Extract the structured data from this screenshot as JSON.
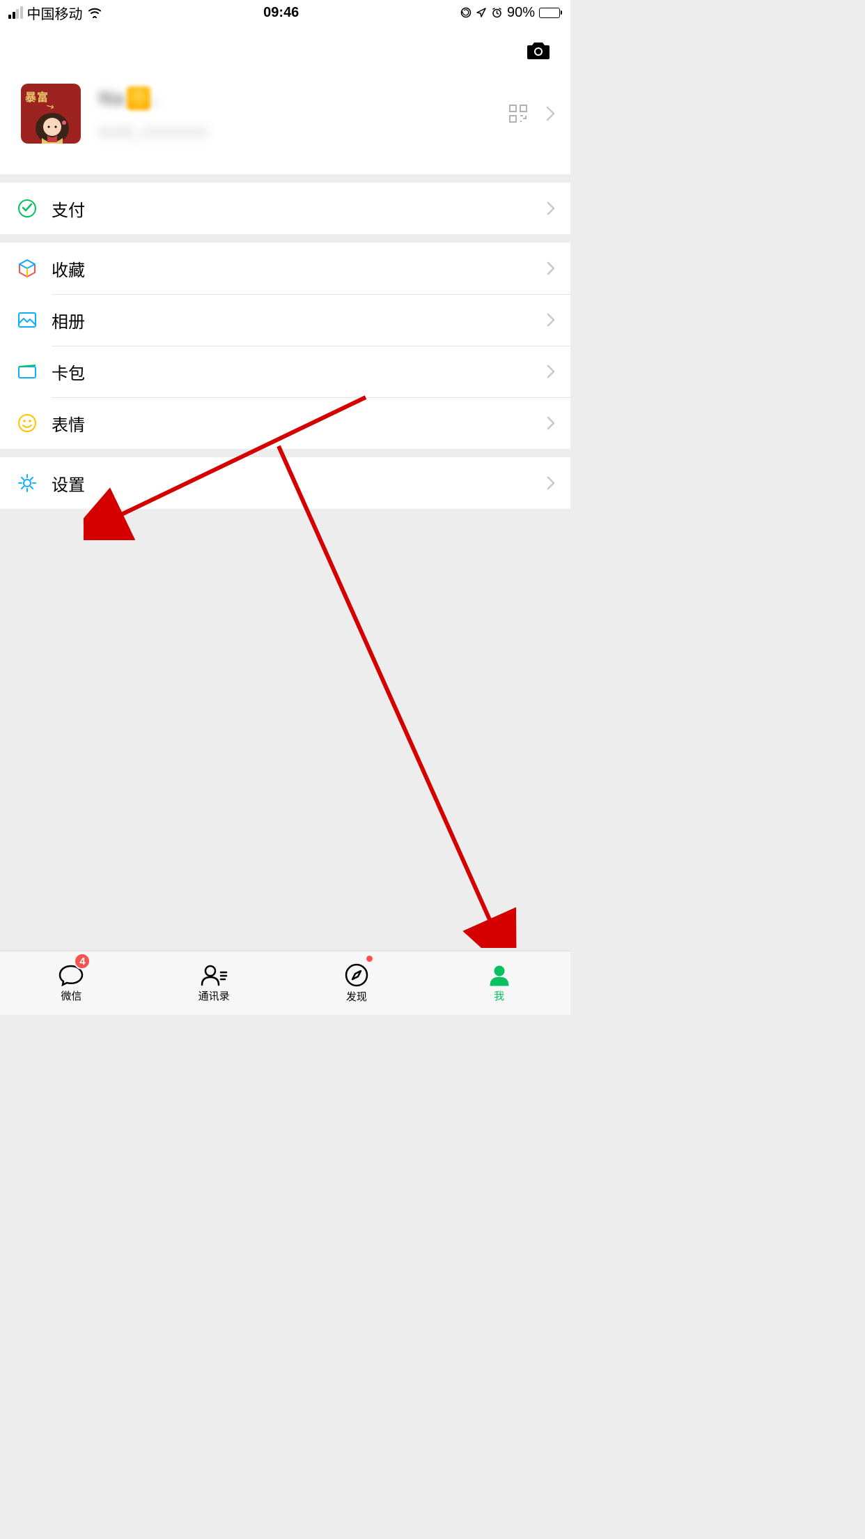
{
  "status_bar": {
    "carrier": "中国移动",
    "time": "09:46",
    "battery_percent": "90%"
  },
  "profile": {
    "avatar_text": "暴富",
    "nickname_blurred": "Na",
    "wechat_id_blurred": "wxid_xxxxxxxx"
  },
  "menu": {
    "items": [
      {
        "label": "支付",
        "icon": "pay"
      },
      {
        "label": "收藏",
        "icon": "favorites"
      },
      {
        "label": "相册",
        "icon": "album"
      },
      {
        "label": "卡包",
        "icon": "cards"
      },
      {
        "label": "表情",
        "icon": "sticker"
      },
      {
        "label": "设置",
        "icon": "settings"
      }
    ]
  },
  "tabbar": {
    "items": [
      {
        "label": "微信",
        "badge": "4"
      },
      {
        "label": "通讯录"
      },
      {
        "label": "发现",
        "dot": true
      },
      {
        "label": "我",
        "active": true
      }
    ]
  },
  "annotation": {
    "arrow1_target": "settings",
    "arrow2_target": "me-tab"
  }
}
